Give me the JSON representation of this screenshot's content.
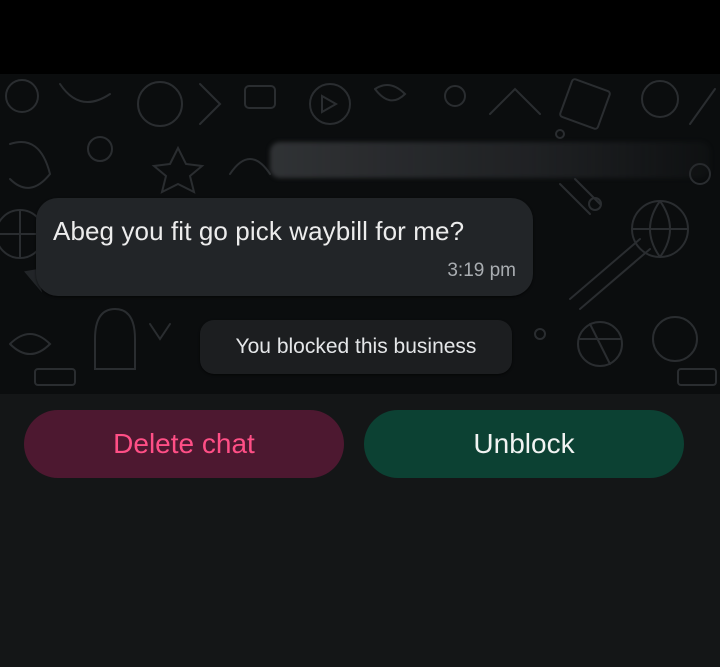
{
  "chat": {
    "message": {
      "text": "Abeg you fit go pick waybill for me?",
      "time": "3:19 pm"
    },
    "system_notice": "You blocked this business",
    "wallpaper_icon": "doodle-pattern-icon"
  },
  "actions": {
    "delete_label": "Delete chat",
    "unblock_label": "Unblock"
  },
  "colors": {
    "background": "#000000",
    "bubble": "#222528",
    "delete_text": "#ff4f86",
    "delete_bg": "#4d1830",
    "unblock_bg": "#0c4133"
  }
}
